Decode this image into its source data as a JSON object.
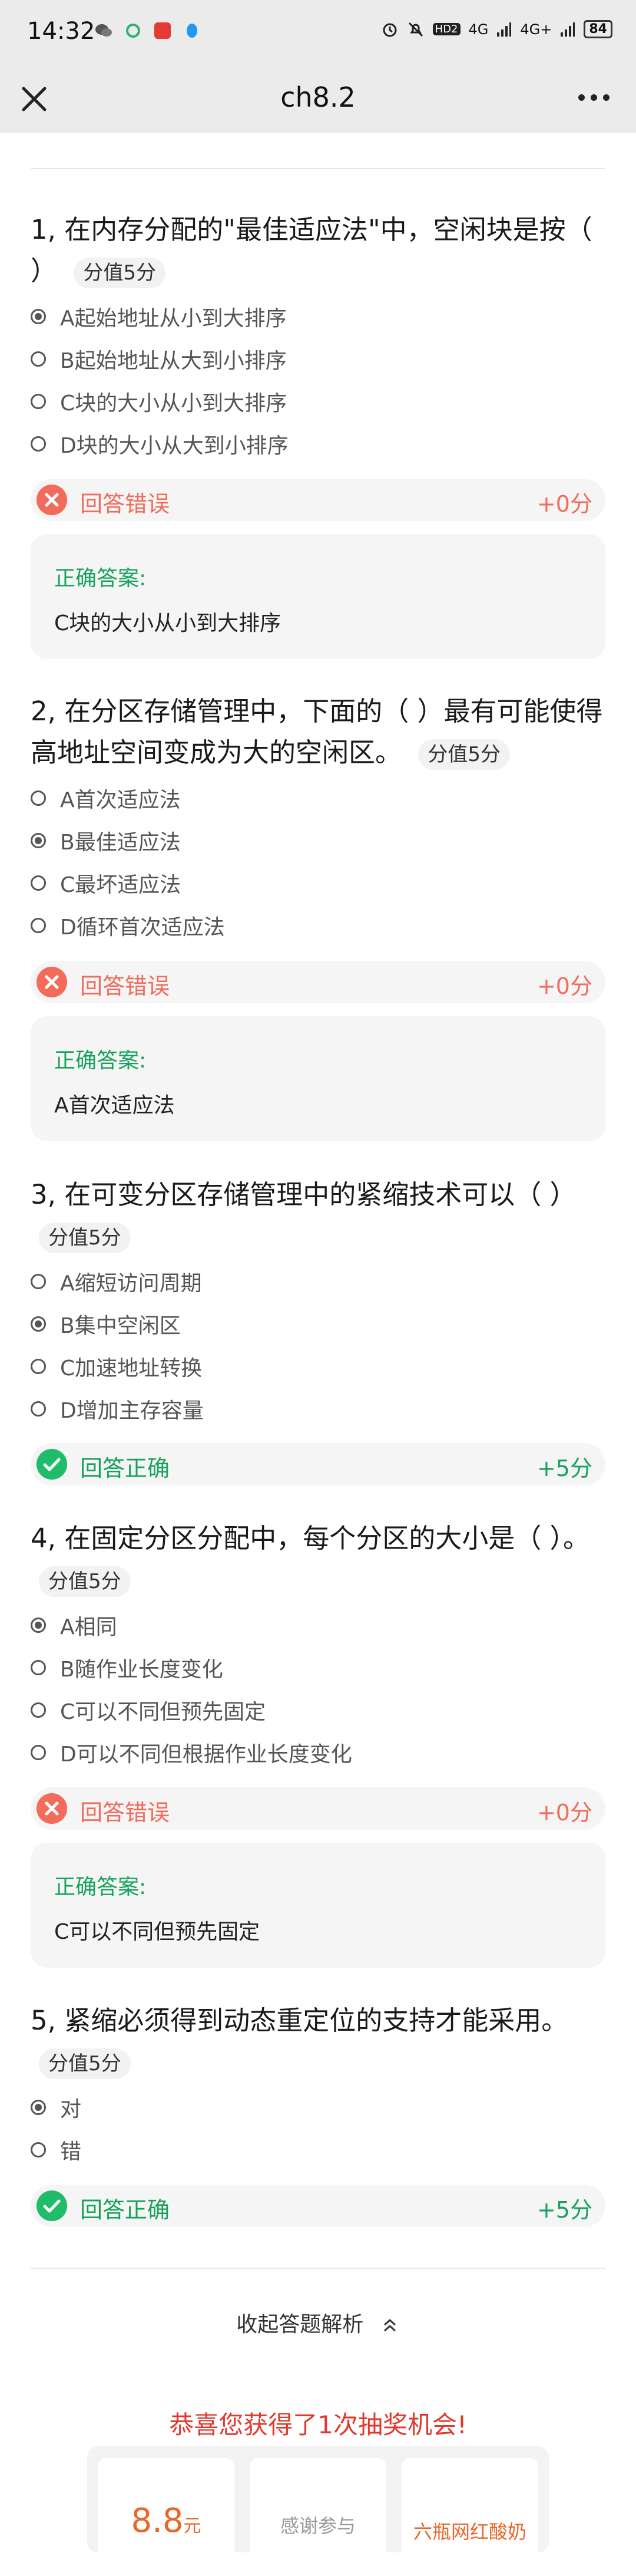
{
  "status_bar": {
    "time": "14:32",
    "battery": "84",
    "network_1": "4G",
    "network_2": "4G+",
    "hd": "HD2"
  },
  "nav": {
    "title": "ch8.2"
  },
  "questions": [
    {
      "title": "1, 在内存分配的\"最佳适应法\"中，空闲块是按（ ）",
      "score": "分值5分",
      "options": [
        "A起始地址从小到大排序",
        "B起始地址从大到小排序",
        "C块的大小从小到大排序",
        "D块的大小从大到小排序"
      ],
      "selected": 0,
      "result": "回答错误",
      "result_score": "+0分",
      "correct": false,
      "answer_label": "正确答案:",
      "answer": "C块的大小从小到大排序"
    },
    {
      "title": "2, 在分区存储管理中，下面的（ ）最有可能使得高地址空间变成为大的空闲区。",
      "score": "分值5分",
      "options": [
        "A首次适应法",
        "B最佳适应法",
        "C最坏适应法",
        "D循环首次适应法"
      ],
      "selected": 1,
      "result": "回答错误",
      "result_score": "+0分",
      "correct": false,
      "answer_label": "正确答案:",
      "answer": "A首次适应法"
    },
    {
      "title": "3, 在可变分区存储管理中的紧缩技术可以（ ）",
      "score": "分值5分",
      "options": [
        "A缩短访问周期",
        "B集中空闲区",
        "C加速地址转换",
        "D增加主存容量"
      ],
      "selected": 1,
      "result": "回答正确",
      "result_score": "+5分",
      "correct": true
    },
    {
      "title": "4, 在固定分区分配中，每个分区的大小是（ ）。",
      "score": "分值5分",
      "options": [
        "A相同",
        "B随作业长度变化",
        "C可以不同但预先固定",
        "D可以不同但根据作业长度变化"
      ],
      "selected": 0,
      "result": "回答错误",
      "result_score": "+0分",
      "correct": false,
      "answer_label": "正确答案:",
      "answer": "C可以不同但预先固定"
    },
    {
      "title": "5, 紧缩必须得到动态重定位的支持才能采用。",
      "score": "分值5分",
      "options": [
        "对",
        "错"
      ],
      "selected": 0,
      "result": "回答正确",
      "result_score": "+5分",
      "correct": true
    }
  ],
  "footer": {
    "collapse_label": "收起答题解析",
    "lottery_title": "恭喜您获得了1次抽奖机会!",
    "prizes": [
      {
        "value": "8.8",
        "unit": "元"
      },
      {
        "label": "感谢参与"
      },
      {
        "label": "六瓶网红酸奶"
      }
    ]
  }
}
